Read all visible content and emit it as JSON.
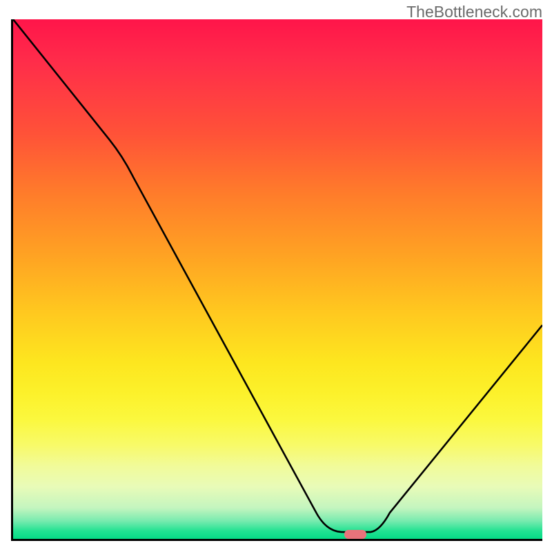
{
  "watermark": "TheBottleneck.com",
  "chart_data": {
    "type": "line",
    "title": "",
    "xlabel": "",
    "ylabel": "",
    "xlim": [
      0,
      100
    ],
    "ylim": [
      0,
      100
    ],
    "series": [
      {
        "name": "curve",
        "x": [
          0,
          18,
          60,
          62,
          68,
          70,
          100
        ],
        "values": [
          100,
          77,
          3.5,
          1,
          1,
          2.5,
          41
        ]
      }
    ],
    "marker": {
      "x_center": 65,
      "y": 1
    },
    "gradient_stops_pct": [
      0,
      8,
      22,
      33,
      45,
      56,
      66,
      72,
      77,
      82,
      86,
      90,
      94,
      96.5,
      98.5,
      100
    ],
    "gradient_colors": [
      "#ff154a",
      "#ff2c4a",
      "#ff5238",
      "#ff7a2b",
      "#ffa123",
      "#ffc71f",
      "#fde61f",
      "#fcf12b",
      "#fbf83e",
      "#f8fa69",
      "#f1fb9a",
      "#e8fbb8",
      "#c4f5bf",
      "#7aebaf",
      "#21e292",
      "#06db86"
    ]
  }
}
